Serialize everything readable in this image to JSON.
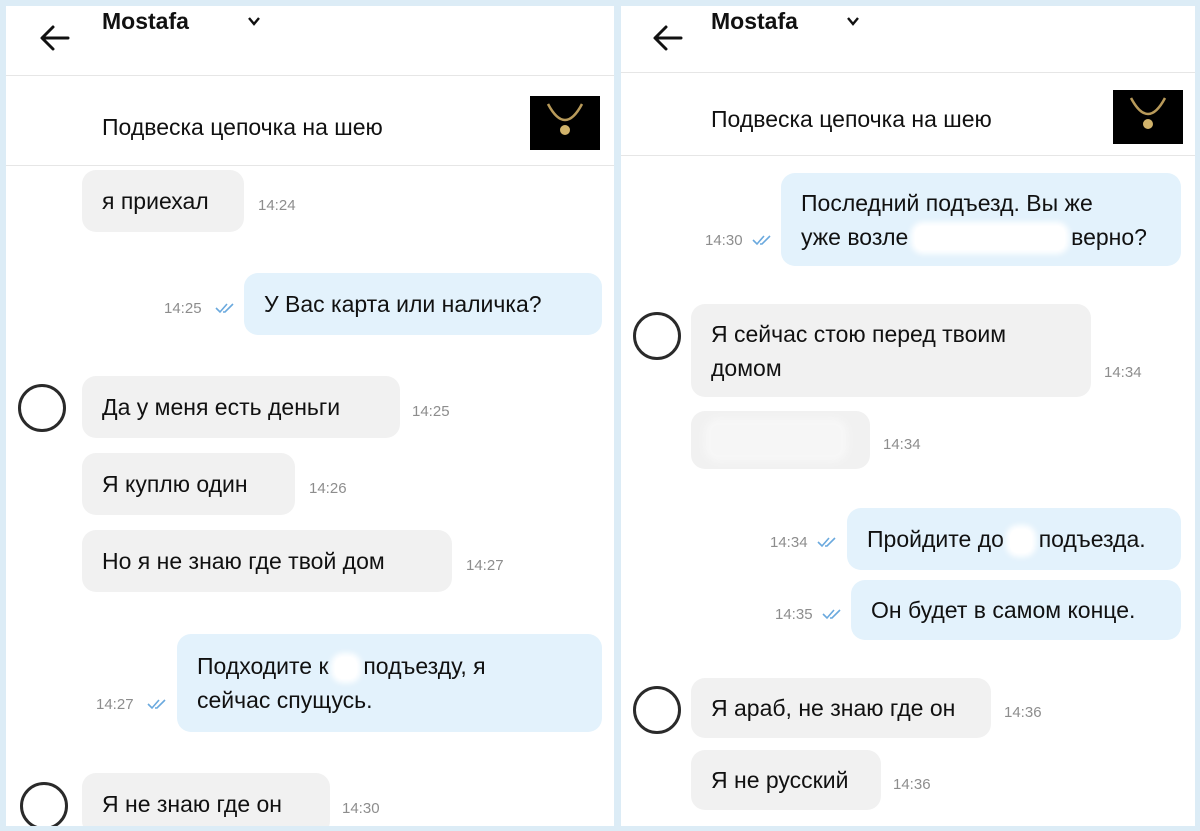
{
  "colors": {
    "incoming": "#f1f1f1",
    "outgoing": "#e3f2fc",
    "tick": "#6aa9de",
    "backdrop": "#dcecf6"
  },
  "left": {
    "header": {
      "name": "Mostafa"
    },
    "product": {
      "title": "Подвеска цепочка на шею"
    },
    "messages": [
      {
        "text": "я приехал",
        "time": "14:24"
      },
      {
        "text": "У Вас карта или наличка?",
        "time": "14:25"
      },
      {
        "text": "Да у меня есть деньги",
        "time": "14:25"
      },
      {
        "text": "Я куплю один",
        "time": "14:26"
      },
      {
        "text": "Но я не знаю где твой дом",
        "time": "14:27"
      },
      {
        "line1_pre": "Подходите к",
        "line1_post": "подъезду, я",
        "line2": "сейчас спущусь.",
        "time": "14:27"
      },
      {
        "text": "Я не знаю где он",
        "time": "14:30"
      }
    ]
  },
  "right": {
    "header": {
      "name": "Mostafa"
    },
    "product": {
      "title": "Подвеска цепочка на шею"
    },
    "messages": [
      {
        "line1": "Последний подъезд. Вы же",
        "line2_pre": "уже возле",
        "line2_post": "верно?",
        "time": "14:30"
      },
      {
        "line1": "Я сейчас стою перед твоим",
        "line2": "домом",
        "time": "14:34"
      },
      {
        "time": "14:34"
      },
      {
        "text_pre": "Пройдите до",
        "text_post": "подъезда.",
        "time": "14:34"
      },
      {
        "text": "Он будет в самом конце.",
        "time": "14:35"
      },
      {
        "text": "Я араб, не знаю где он",
        "time": "14:36"
      },
      {
        "text": "Я не русский",
        "time": "14:36"
      }
    ]
  }
}
